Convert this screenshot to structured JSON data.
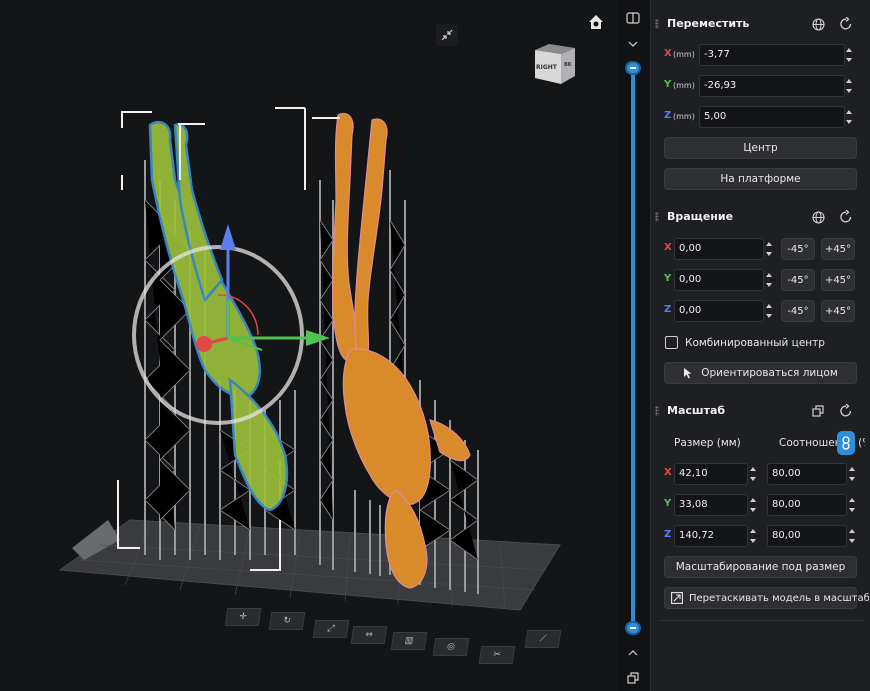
{
  "viewport": {
    "cube_right": "RIGHT",
    "cube_back": "BK"
  },
  "move": {
    "title": "Переместить",
    "x_axis": "X",
    "y_axis": "Y",
    "z_axis": "Z",
    "unit": "(mm)",
    "x_value": "-3,77",
    "y_value": "-26,93",
    "z_value": "5,00",
    "center_label": "Центр",
    "platform_label": "На платформе"
  },
  "rotation": {
    "title": "Вращение",
    "x_value": "0,00",
    "y_value": "0,00",
    "z_value": "0,00",
    "minus45": "-45°",
    "plus45": "+45°",
    "combined_center_label": "Комбинированный центр",
    "orient_face_label": "Ориентироваться лицом"
  },
  "scale": {
    "title": "Масштаб",
    "size_header": "Размер (мм)",
    "ratio_header": "Соотношение (%)",
    "x_size": "42,10",
    "x_ratio": "80,00",
    "y_size": "33,08",
    "y_ratio": "80,00",
    "z_size": "140,72",
    "z_ratio": "80,00",
    "fit_label": "Масштабирование под размер",
    "drag_label": "Перетаскивать модель в масштабе"
  },
  "colors": {
    "accent": "#2e8fd8",
    "x_axis": "#e04848",
    "y_axis": "#4fc24f",
    "z_axis": "#5a7ef0",
    "model_orange": "#d98a2b",
    "model_green": "#9bbf3a"
  }
}
